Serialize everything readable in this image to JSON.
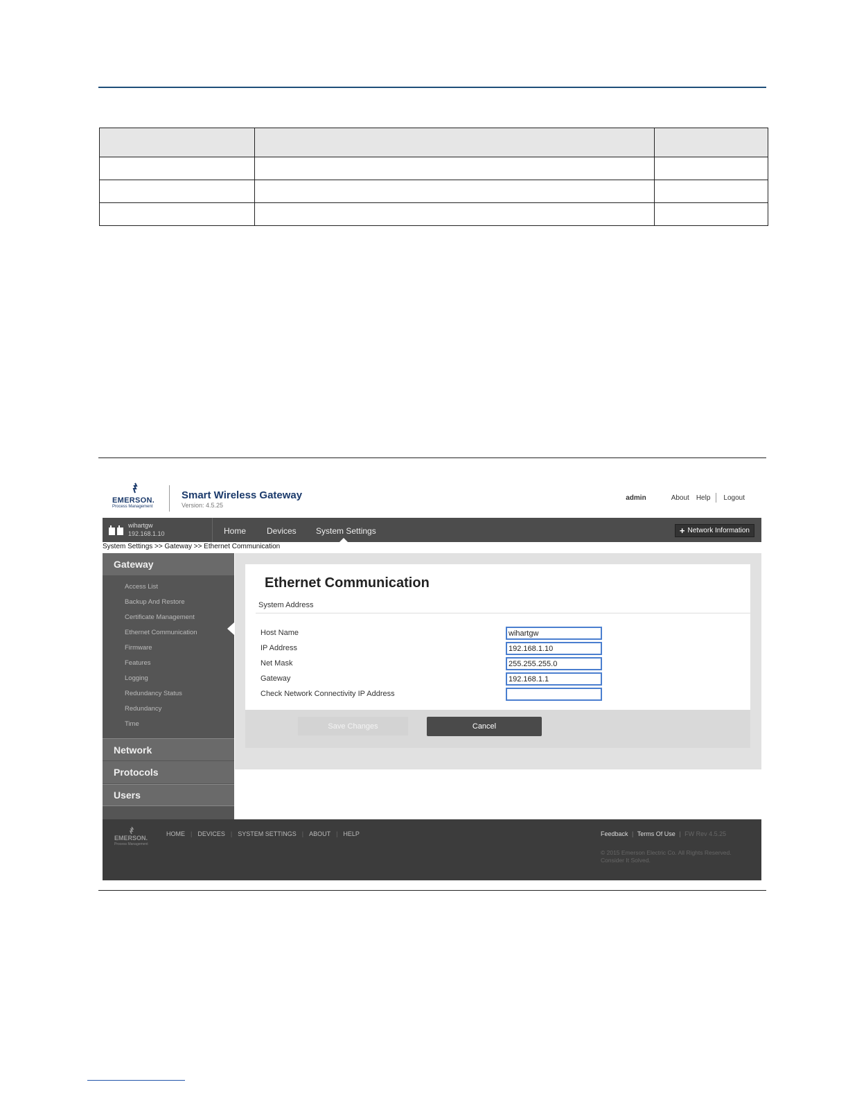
{
  "header": {
    "brand": "EMERSON.",
    "brand_sub": "Process Management",
    "app_title": "Smart Wireless Gateway",
    "version": "Version: 4.5.25",
    "username": "admin",
    "links": [
      "About",
      "Help",
      "Logout"
    ]
  },
  "navbar": {
    "hostname": "wihartgw",
    "host_ip": "192.168.1.10",
    "items": [
      "Home",
      "Devices",
      "System Settings"
    ],
    "active_item": "System Settings",
    "network_info_label": "Network Information"
  },
  "breadcrumb": "System Settings >> Gateway >> Ethernet Communication",
  "sidebar": {
    "sections": [
      "Gateway",
      "Network",
      "Protocols",
      "Users"
    ],
    "gateway_items": [
      "Access List",
      "Backup And Restore",
      "Certificate Management",
      "Ethernet Communication",
      "Firmware",
      "Features",
      "Logging",
      "Redundancy Status",
      "Redundancy",
      "Time"
    ],
    "active_item": "Ethernet Communication"
  },
  "panel": {
    "title": "Ethernet Communication",
    "subtitle": "System Address",
    "fields": [
      {
        "label": "Host Name",
        "value": "wihartgw"
      },
      {
        "label": "IP Address",
        "value": "192.168.1.10"
      },
      {
        "label": "Net Mask",
        "value": "255.255.255.0"
      },
      {
        "label": "Gateway",
        "value": "192.168.1.1"
      },
      {
        "label": "Check Network Connectivity IP Address",
        "value": ""
      }
    ],
    "save_label": "Save Changes",
    "cancel_label": "Cancel"
  },
  "footer": {
    "brand": "EMERSON.",
    "brand_sub": "Process Management",
    "links": [
      "HOME",
      "DEVICES",
      "SYSTEM SETTINGS",
      "ABOUT",
      "HELP"
    ],
    "feedback": "Feedback",
    "terms": "Terms Of Use",
    "fw_rev": "FW Rev 4.5.25",
    "copyright": "© 2015 Emerson Electric Co. All Rights Reserved.",
    "tagline": "Consider It Solved."
  },
  "colors": {
    "brand_blue": "#1b3a6b",
    "nav_bg": "#4c4c4c",
    "sidebar_bg": "#555555",
    "input_border": "#4a7ecf",
    "footer_bg": "#3c3c3c"
  }
}
